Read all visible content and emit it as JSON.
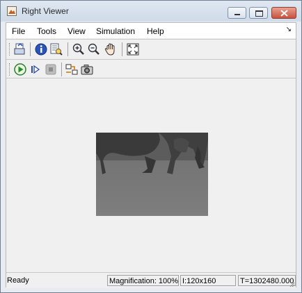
{
  "window": {
    "title": "Right Viewer"
  },
  "menu": {
    "items": [
      "File",
      "Tools",
      "View",
      "Simulation",
      "Help"
    ]
  },
  "toolbar1": [
    {
      "name": "print-icon"
    },
    {
      "name": "info-icon"
    },
    {
      "name": "memory-inspect-icon"
    },
    {
      "name": "zoom-in-icon"
    },
    {
      "name": "zoom-out-icon"
    },
    {
      "name": "pan-hand-icon"
    },
    {
      "name": "fit-to-window-icon"
    }
  ],
  "toolbar2": [
    {
      "name": "run-icon"
    },
    {
      "name": "step-forward-icon"
    },
    {
      "name": "stop-icon"
    },
    {
      "name": "highlight-signal-icon"
    },
    {
      "name": "snapshot-camera-icon"
    }
  ],
  "status": {
    "state": "Ready",
    "magnification": "Magnification: 100%",
    "image_info": "I:120x160",
    "time": "T=1302480.000"
  }
}
